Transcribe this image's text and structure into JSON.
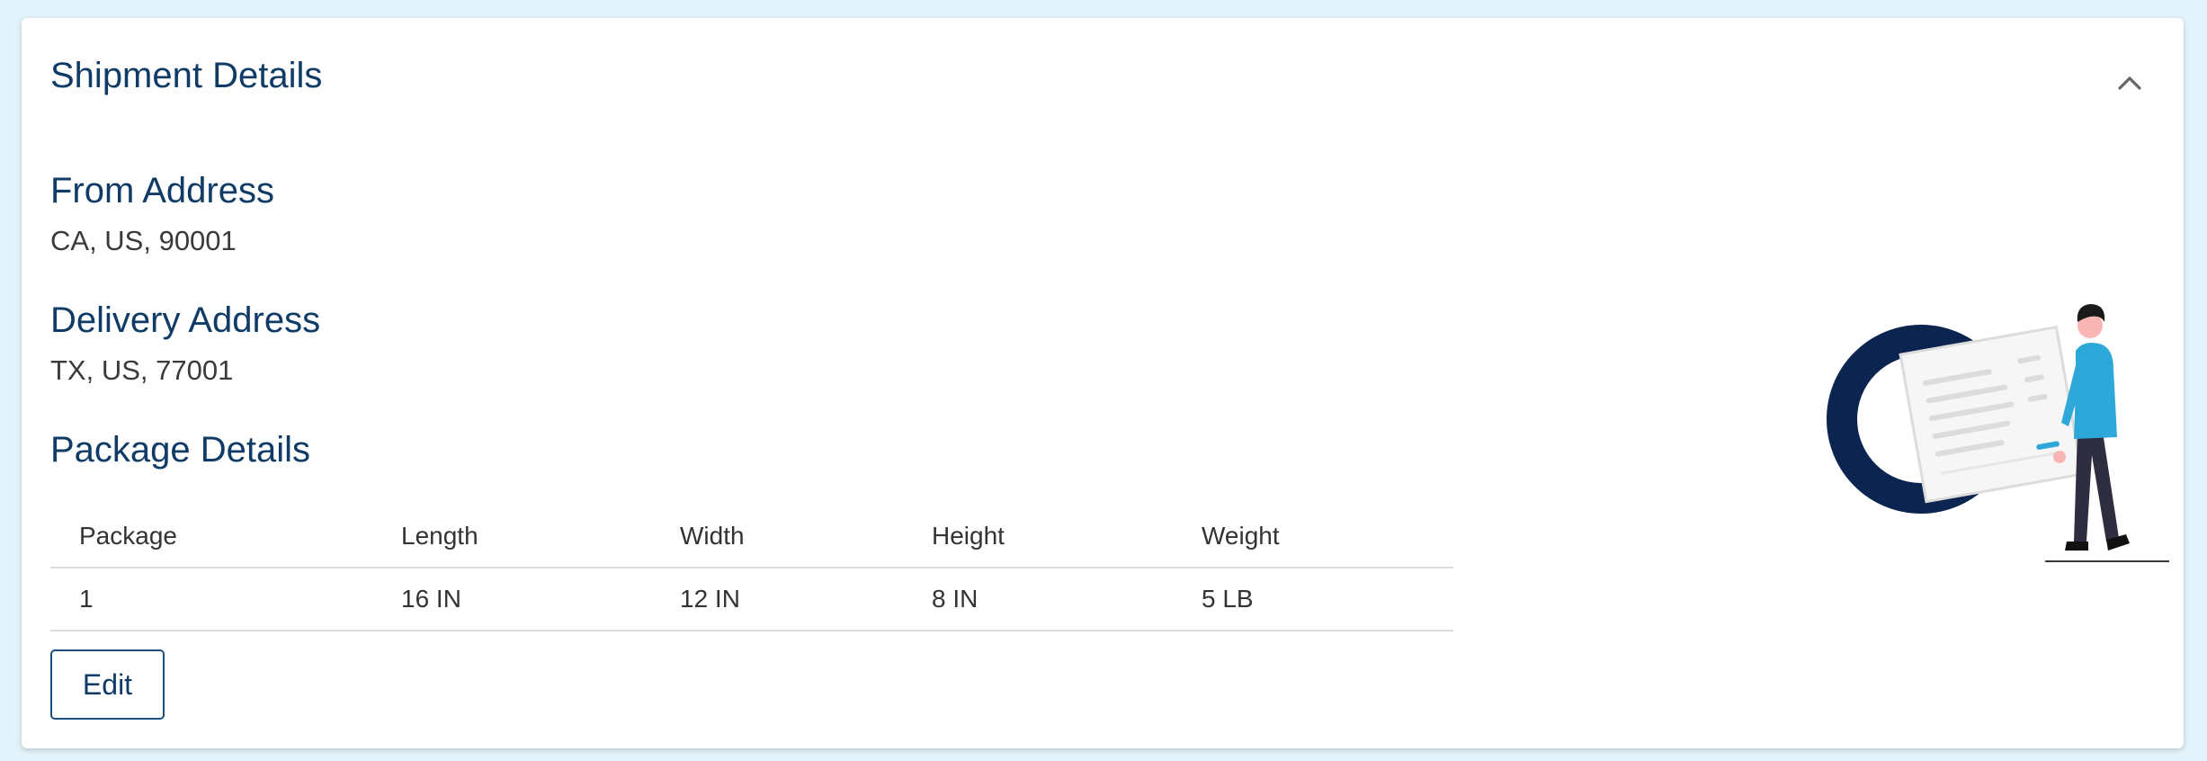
{
  "card": {
    "title": "Shipment Details",
    "toggle_icon": "chevron-up-icon"
  },
  "from_address": {
    "heading": "From Address",
    "value": "CA, US, 90001"
  },
  "delivery_address": {
    "heading": "Delivery Address",
    "value": "TX, US, 77001"
  },
  "package_details": {
    "heading": "Package Details",
    "columns": [
      "Package",
      "Length",
      "Width",
      "Height",
      "Weight"
    ],
    "rows": [
      [
        "1",
        "16 IN",
        "12 IN",
        "8 IN",
        "5 LB"
      ]
    ]
  },
  "actions": {
    "edit_label": "Edit"
  },
  "colors": {
    "page_background": "#e3f3fb",
    "heading": "#0f3b66",
    "body_text": "#3a3a3a",
    "accent_navy": "#0b2550",
    "accent_cyan": "#2ea8d8"
  },
  "illustration": {
    "name": "person-with-document-illustration"
  }
}
